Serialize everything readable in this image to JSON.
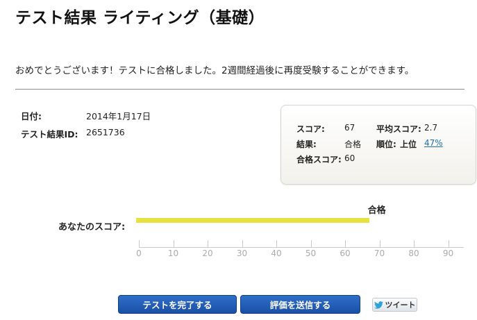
{
  "header": {
    "title": "テスト結果  ライティング（基礎）"
  },
  "message": "おめでとうございます！テストに合格しました。2週間経過後に再度受験することができます。",
  "meta": {
    "date_label": "日付:",
    "date_value": "2014年1月17日",
    "id_label": "テスト結果ID:",
    "id_value": "2651736"
  },
  "score_box": {
    "score_label": "スコア:",
    "score_value": "67",
    "avg_label": "平均スコア:",
    "avg_value": "2.7",
    "result_label": "結果:",
    "result_value": "合格",
    "rank_label": "順位:",
    "rank_value": "上位",
    "rank_percent": "47%",
    "pass_score_label": "合格スコア:",
    "pass_score_value": "60"
  },
  "chart_data": {
    "type": "bar",
    "orientation": "horizontal",
    "categories": [
      "あなたのスコア:"
    ],
    "values": [
      67
    ],
    "annotation": "合格",
    "xlim": [
      0,
      93
    ],
    "ticks": [
      0,
      10,
      20,
      30,
      40,
      50,
      60,
      70,
      80,
      90
    ],
    "bar_color": "#e8e040"
  },
  "buttons": {
    "complete": "テストを完了する",
    "send_rating": "評価を送信する",
    "tweet": "ツイート"
  },
  "colors": {
    "button_blue": "#1b4fa6",
    "link_blue": "#1a6fb3",
    "bar_yellow": "#e8e040"
  }
}
